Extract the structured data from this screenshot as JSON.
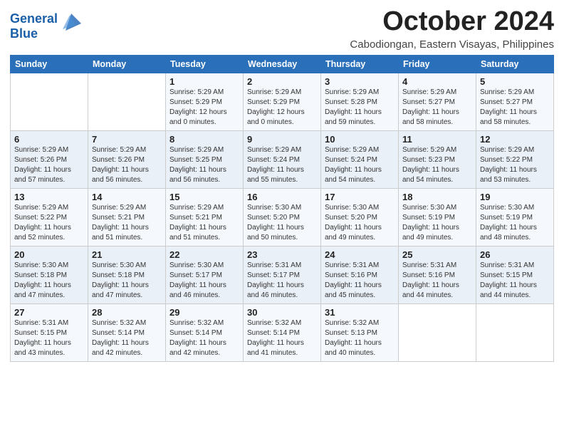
{
  "logo": {
    "line1": "General",
    "line2": "Blue"
  },
  "title": "October 2024",
  "subtitle": "Cabodiongan, Eastern Visayas, Philippines",
  "days_of_week": [
    "Sunday",
    "Monday",
    "Tuesday",
    "Wednesday",
    "Thursday",
    "Friday",
    "Saturday"
  ],
  "weeks": [
    [
      {
        "day": "",
        "detail": ""
      },
      {
        "day": "",
        "detail": ""
      },
      {
        "day": "1",
        "detail": "Sunrise: 5:29 AM\nSunset: 5:29 PM\nDaylight: 12 hours and 0 minutes."
      },
      {
        "day": "2",
        "detail": "Sunrise: 5:29 AM\nSunset: 5:29 PM\nDaylight: 12 hours and 0 minutes."
      },
      {
        "day": "3",
        "detail": "Sunrise: 5:29 AM\nSunset: 5:28 PM\nDaylight: 11 hours and 59 minutes."
      },
      {
        "day": "4",
        "detail": "Sunrise: 5:29 AM\nSunset: 5:27 PM\nDaylight: 11 hours and 58 minutes."
      },
      {
        "day": "5",
        "detail": "Sunrise: 5:29 AM\nSunset: 5:27 PM\nDaylight: 11 hours and 58 minutes."
      }
    ],
    [
      {
        "day": "6",
        "detail": "Sunrise: 5:29 AM\nSunset: 5:26 PM\nDaylight: 11 hours and 57 minutes."
      },
      {
        "day": "7",
        "detail": "Sunrise: 5:29 AM\nSunset: 5:26 PM\nDaylight: 11 hours and 56 minutes."
      },
      {
        "day": "8",
        "detail": "Sunrise: 5:29 AM\nSunset: 5:25 PM\nDaylight: 11 hours and 56 minutes."
      },
      {
        "day": "9",
        "detail": "Sunrise: 5:29 AM\nSunset: 5:24 PM\nDaylight: 11 hours and 55 minutes."
      },
      {
        "day": "10",
        "detail": "Sunrise: 5:29 AM\nSunset: 5:24 PM\nDaylight: 11 hours and 54 minutes."
      },
      {
        "day": "11",
        "detail": "Sunrise: 5:29 AM\nSunset: 5:23 PM\nDaylight: 11 hours and 54 minutes."
      },
      {
        "day": "12",
        "detail": "Sunrise: 5:29 AM\nSunset: 5:22 PM\nDaylight: 11 hours and 53 minutes."
      }
    ],
    [
      {
        "day": "13",
        "detail": "Sunrise: 5:29 AM\nSunset: 5:22 PM\nDaylight: 11 hours and 52 minutes."
      },
      {
        "day": "14",
        "detail": "Sunrise: 5:29 AM\nSunset: 5:21 PM\nDaylight: 11 hours and 51 minutes."
      },
      {
        "day": "15",
        "detail": "Sunrise: 5:29 AM\nSunset: 5:21 PM\nDaylight: 11 hours and 51 minutes."
      },
      {
        "day": "16",
        "detail": "Sunrise: 5:30 AM\nSunset: 5:20 PM\nDaylight: 11 hours and 50 minutes."
      },
      {
        "day": "17",
        "detail": "Sunrise: 5:30 AM\nSunset: 5:20 PM\nDaylight: 11 hours and 49 minutes."
      },
      {
        "day": "18",
        "detail": "Sunrise: 5:30 AM\nSunset: 5:19 PM\nDaylight: 11 hours and 49 minutes."
      },
      {
        "day": "19",
        "detail": "Sunrise: 5:30 AM\nSunset: 5:19 PM\nDaylight: 11 hours and 48 minutes."
      }
    ],
    [
      {
        "day": "20",
        "detail": "Sunrise: 5:30 AM\nSunset: 5:18 PM\nDaylight: 11 hours and 47 minutes."
      },
      {
        "day": "21",
        "detail": "Sunrise: 5:30 AM\nSunset: 5:18 PM\nDaylight: 11 hours and 47 minutes."
      },
      {
        "day": "22",
        "detail": "Sunrise: 5:30 AM\nSunset: 5:17 PM\nDaylight: 11 hours and 46 minutes."
      },
      {
        "day": "23",
        "detail": "Sunrise: 5:31 AM\nSunset: 5:17 PM\nDaylight: 11 hours and 46 minutes."
      },
      {
        "day": "24",
        "detail": "Sunrise: 5:31 AM\nSunset: 5:16 PM\nDaylight: 11 hours and 45 minutes."
      },
      {
        "day": "25",
        "detail": "Sunrise: 5:31 AM\nSunset: 5:16 PM\nDaylight: 11 hours and 44 minutes."
      },
      {
        "day": "26",
        "detail": "Sunrise: 5:31 AM\nSunset: 5:15 PM\nDaylight: 11 hours and 44 minutes."
      }
    ],
    [
      {
        "day": "27",
        "detail": "Sunrise: 5:31 AM\nSunset: 5:15 PM\nDaylight: 11 hours and 43 minutes."
      },
      {
        "day": "28",
        "detail": "Sunrise: 5:32 AM\nSunset: 5:14 PM\nDaylight: 11 hours and 42 minutes."
      },
      {
        "day": "29",
        "detail": "Sunrise: 5:32 AM\nSunset: 5:14 PM\nDaylight: 11 hours and 42 minutes."
      },
      {
        "day": "30",
        "detail": "Sunrise: 5:32 AM\nSunset: 5:14 PM\nDaylight: 11 hours and 41 minutes."
      },
      {
        "day": "31",
        "detail": "Sunrise: 5:32 AM\nSunset: 5:13 PM\nDaylight: 11 hours and 40 minutes."
      },
      {
        "day": "",
        "detail": ""
      },
      {
        "day": "",
        "detail": ""
      }
    ]
  ]
}
